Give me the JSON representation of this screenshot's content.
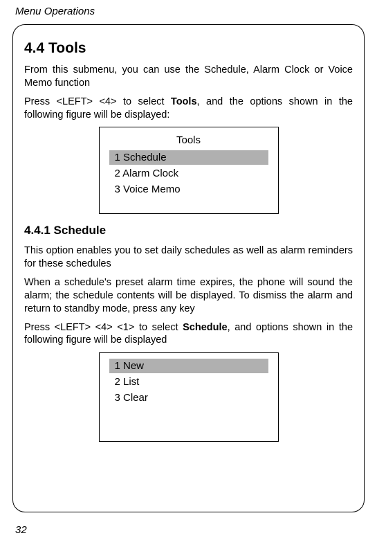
{
  "header": {
    "chapter_title": "Menu Operations"
  },
  "section": {
    "heading": "4.4 Tools",
    "intro_p1": "From this submenu, you can use the Schedule, Alarm Clock or Voice Memo function",
    "intro_p2a": "Press <LEFT> <4> to select ",
    "intro_p2_bold": "Tools",
    "intro_p2b": ", and the options shown in the following figure will be displayed:"
  },
  "tools_screen": {
    "title": "Tools",
    "items": [
      "1 Schedule",
      "2 Alarm Clock",
      "3 Voice Memo"
    ]
  },
  "subsection": {
    "heading": "4.4.1 Schedule",
    "p1": "This option enables you to set daily schedules as well as alarm reminders for these schedules",
    "p2": "When a schedule's preset alarm time expires, the phone will sound the alarm; the schedule contents will be displayed. To dismiss the alarm and return to standby mode, press any key",
    "p3a": "Press <LEFT> <4> <1> to select ",
    "p3_bold": "Schedule",
    "p3b": ", and options shown in the following figure will be displayed"
  },
  "schedule_screen": {
    "items": [
      "1 New",
      "2 List",
      "3 Clear"
    ]
  },
  "page_number": "32"
}
